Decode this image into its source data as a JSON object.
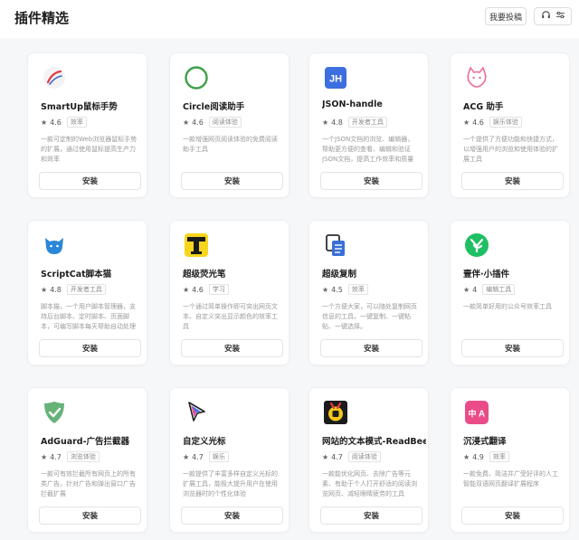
{
  "header": {
    "title": "插件精选",
    "submit_label": "我要投稿",
    "icons": [
      "headset-icon",
      "settings-sliders-icon"
    ]
  },
  "install_label": "安装",
  "plugins": [
    {
      "name": "SmartUp鼠标手势",
      "rating": "4.6",
      "tag": "效率",
      "desc": "一款可定制的Web浏览器鼠标手势的扩展，通过使用鼠标提高生产力和效率",
      "icon": "smartup-gesture-icon"
    },
    {
      "name": "Circle阅读助手",
      "rating": "4.6",
      "tag": "阅读体验",
      "desc": "一款增强网页阅读体验的免费阅读助手工具",
      "icon": "circle-reader-icon"
    },
    {
      "name": "JSON-handle",
      "rating": "4.8",
      "tag": "开发者工具",
      "desc": "一个JSON文档的浏览、编辑器，帮助更方便的查看、编辑和验证JSON文档，提高工作效率和质量",
      "icon": "json-handle-icon"
    },
    {
      "name": "ACG 助手",
      "rating": "4.6",
      "tag": "娱乐体验",
      "desc": "一个提供了方便功能和快捷方式，以增强用户的浏览和使用体验的扩展工具",
      "icon": "acg-cat-icon"
    },
    {
      "name": "ScriptCat脚本猫",
      "rating": "4.8",
      "tag": "开发者工具",
      "desc": "脚本猫，一个用户脚本管理器，支持后台脚本、定时脚本、页面脚本，可编写脚本每天帮助自动处理事务",
      "icon": "scriptcat-icon"
    },
    {
      "name": "超级荧光笔",
      "rating": "4.6",
      "tag": "学习",
      "desc": "一个通过简单操作即可突出网页文本、自定义突出显示颜色的效率工具",
      "icon": "highlighter-icon"
    },
    {
      "name": "超级复制",
      "rating": "4.5",
      "tag": "效率",
      "desc": "一个方便大家，可以随处复制网页信息的工具，一键复制、一键粘贴、一键选择。",
      "icon": "super-copy-icon"
    },
    {
      "name": "壹伴·小插件",
      "rating": "4",
      "tag": "编辑工具",
      "desc": "一款简单好用的公众号效率工具",
      "icon": "yiban-icon"
    },
    {
      "name": "AdGuard-广告拦截器",
      "rating": "4.7",
      "tag": "浏览体验",
      "desc": "一款可有效拦截所有网页上的所有类广告，针对广告和弹出窗口广告拦截扩展",
      "icon": "adguard-shield-icon"
    },
    {
      "name": "自定义光标",
      "rating": "4.7",
      "tag": "娱乐",
      "desc": "一款提供了丰富多样自定义光标的扩展工具，能极大提升用户在使用浏览器时的个性化体验",
      "icon": "custom-cursor-icon"
    },
    {
      "name": "网站的文本模式-ReadBee",
      "rating": "4.7",
      "tag": "阅读体验",
      "desc": "一款能优化网页、去除广告等元素、有助于个人打开舒适的阅读浏览网页、减轻眼睛疲劳的工具",
      "icon": "readbee-icon"
    },
    {
      "name": "沉浸式翻译",
      "rating": "4.9",
      "tag": "效率",
      "desc": "一款免费、简洁并广受好评的人工智能双语网页翻译扩展程序",
      "icon": "immersive-translate-icon"
    }
  ]
}
